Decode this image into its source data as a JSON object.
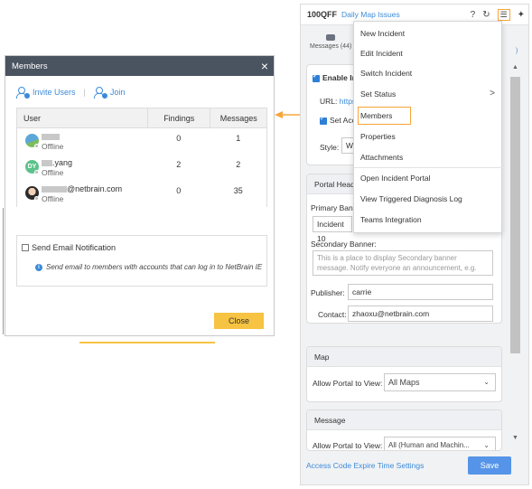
{
  "members_dialog": {
    "title": "Members",
    "close_glyph": "×",
    "invite_users": "Invite Users",
    "separator": "|",
    "join": "Join",
    "columns": [
      "User",
      "Findings",
      "Messages"
    ],
    "rows": [
      {
        "name": "",
        "status": "Offline",
        "findings": "0",
        "messages": "1"
      },
      {
        "name": ".yang",
        "status": "Offline",
        "findings": "2",
        "messages": "2"
      },
      {
        "name": "@netbrain.com",
        "status": "Offline",
        "findings": "0",
        "messages": "35"
      }
    ],
    "avatar_initials": "DY",
    "send_email_label": "Send Email Notification",
    "email_info": "Send email to members with accounts that can log in to NetBrain IE",
    "close_label": "Close"
  },
  "panel": {
    "title": "100QFF",
    "subtitle": "Daily Map Issues",
    "icons": {
      "help": "?",
      "refresh": "↻",
      "menu": "☰",
      "pin": "✦"
    },
    "tab_messages": "Messages (44)",
    "tab_right_fragment": ")",
    "enable_label": "Enable In",
    "url_label": "URL:",
    "url_value": "https",
    "set_acc_label": "Set Acc",
    "style_label": "Style:",
    "style_value": "W",
    "portal_header_title": "Portal Head",
    "primary_banner_label": "Primary Ban",
    "primary_banner_value": "Incident 10",
    "secondary_banner_label": "Secondary Banner:",
    "secondary_banner_placeholder": "This is a place to display Secondary banner message. Notify everyone an announcement, e.g.",
    "publisher_label": "Publisher:",
    "publisher_value": "carrie",
    "contact_label": "Contact:",
    "contact_value": "zhaoxu@netbrain.com",
    "map_title": "Map",
    "allow_view_label": "Allow Portal to View:",
    "map_value": "All Maps",
    "message_title": "Message",
    "message_allow_label": "Allow Portal to View:",
    "message_value": "All (Human and Machin...",
    "access_link": "Access Code Expire Time Settings",
    "save_label": "Save"
  },
  "menu": {
    "items": [
      "New Incident",
      "Edit Incident",
      "Switch Incident",
      "Set Status",
      "Members",
      "Properties",
      "Attachments",
      "Open Incident Portal",
      "View Triggered Diagnosis Log",
      "Teams Integration"
    ],
    "submenu_arrow": ">",
    "highlighted": "Members"
  },
  "colors": {
    "accent": "#3c8bd9",
    "highlight": "#f7a53a",
    "button_yellow": "#f7c342",
    "header_dark": "#4a5360",
    "save_blue": "#5594e8"
  }
}
